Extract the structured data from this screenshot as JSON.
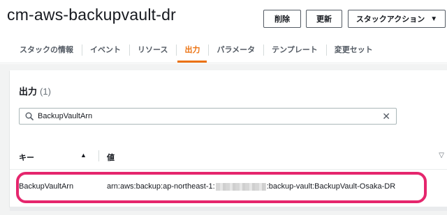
{
  "header": {
    "title": "cm-aws-backupvault-dr",
    "buttons": {
      "delete": "削除",
      "update": "更新",
      "stack_actions": "スタックアクション"
    }
  },
  "tabs": [
    {
      "label": "スタックの情報",
      "active": false
    },
    {
      "label": "イベント",
      "active": false
    },
    {
      "label": "リソース",
      "active": false
    },
    {
      "label": "出力",
      "active": true
    },
    {
      "label": "パラメータ",
      "active": false
    },
    {
      "label": "テンプレート",
      "active": false
    },
    {
      "label": "変更セット",
      "active": false
    }
  ],
  "outputs": {
    "title": "出力",
    "count": "(1)",
    "search": {
      "value": "BackupVaultArn"
    },
    "columns": {
      "key": "キー",
      "value": "値"
    },
    "rows": [
      {
        "key": "BackupVaultArn",
        "value_prefix": "arn:aws:backup:ap-northeast-1:",
        "value_suffix": ":backup-vault:BackupVault-Osaka-DR"
      }
    ]
  },
  "colors": {
    "accent": "#ec7211",
    "highlight": "#e5266d"
  },
  "icons": [
    "search-icon",
    "clear-icon",
    "sort-ascending-icon",
    "caret-down-icon"
  ]
}
